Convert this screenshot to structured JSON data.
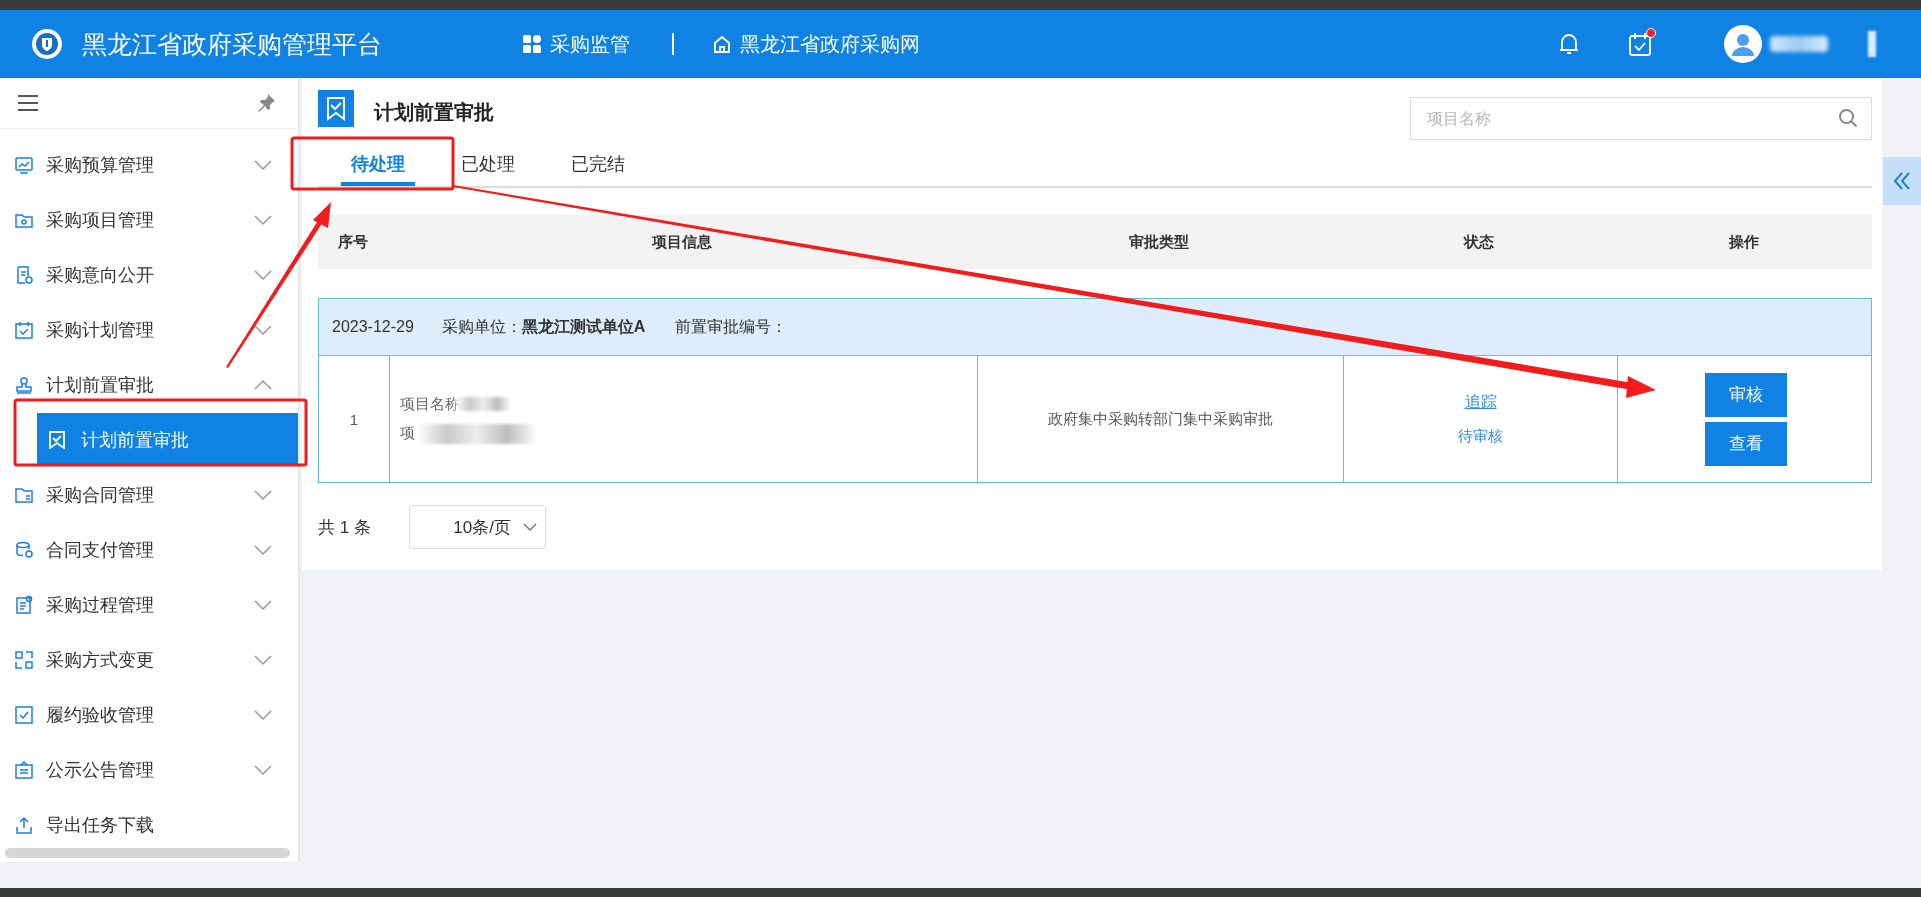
{
  "header": {
    "title": "黑龙江省政府采购管理平台",
    "nav": [
      {
        "label": "采购监管",
        "kind": "grid"
      },
      {
        "label": "黑龙江省政府采购网",
        "kind": "home"
      }
    ],
    "todo_unread": true,
    "user_redacted": true
  },
  "sidebar": {
    "items": [
      {
        "label": "采购预算管理",
        "expanded": false
      },
      {
        "label": "采购项目管理",
        "expanded": false
      },
      {
        "label": "采购意向公开",
        "expanded": false
      },
      {
        "label": "采购计划管理",
        "expanded": false
      },
      {
        "label": "计划前置审批",
        "expanded": true,
        "children": [
          {
            "label": "计划前置审批",
            "selected": true
          }
        ]
      },
      {
        "label": "采购合同管理",
        "expanded": false
      },
      {
        "label": "合同支付管理",
        "expanded": false
      },
      {
        "label": "采购过程管理",
        "expanded": false
      },
      {
        "label": "采购方式变更",
        "expanded": false
      },
      {
        "label": "履约验收管理",
        "expanded": false
      },
      {
        "label": "公示公告管理",
        "expanded": false
      },
      {
        "label": "导出任务下载",
        "kind": "link"
      }
    ]
  },
  "page": {
    "title": "计划前置审批",
    "search": {
      "placeholder": "项目名称"
    },
    "tabs": [
      {
        "label": "待处理",
        "selected": true
      },
      {
        "label": "已处理",
        "selected": false
      },
      {
        "label": "已完结",
        "selected": false
      }
    ],
    "table": {
      "columns": [
        "序号",
        "项目信息",
        "审批类型",
        "状态",
        "操作"
      ],
      "groups": [
        {
          "date": "2023-12-29",
          "unit_label": "采购单位：",
          "unit": "黑龙江测试单位A",
          "code_label": "前置审批编号：",
          "rows": [
            {
              "index": "1",
              "info": [
                {
                  "text": "项目名称",
                  "redacted": true
                },
                {
                  "text": "项",
                  "redacted": true
                }
              ],
              "approval_type": "政府集中采购转部门集中采购审批",
              "status_link": "追踪",
              "status": "待审核",
              "actions": [
                "审核",
                "查看"
              ]
            }
          ]
        }
      ]
    },
    "pagination": {
      "total": "共 1 条",
      "page_size": "10条/页"
    }
  }
}
